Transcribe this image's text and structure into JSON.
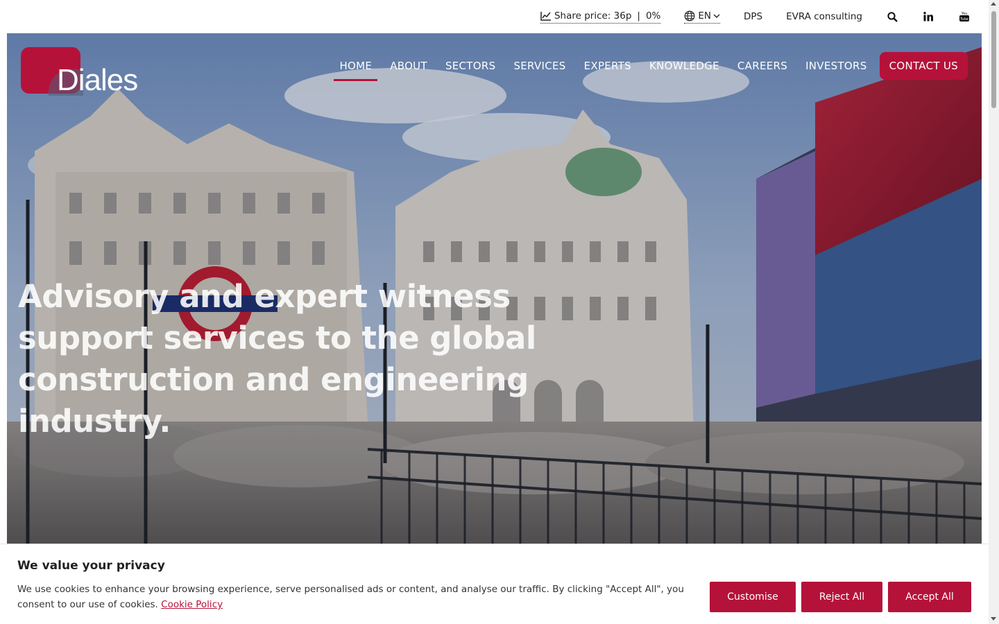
{
  "topbar": {
    "share_price_label": "Share price: 36p",
    "share_separator": "|",
    "share_change": "0%",
    "language": "EN",
    "dps_label": "DPS",
    "evra_label": "EVRA consulting"
  },
  "logo": {
    "text": "Diales"
  },
  "nav": {
    "items": [
      {
        "label": "HOME"
      },
      {
        "label": "ABOUT"
      },
      {
        "label": "SECTORS"
      },
      {
        "label": "SERVICES"
      },
      {
        "label": "EXPERTS"
      },
      {
        "label": "KNOWLEDGE"
      },
      {
        "label": "CAREERS"
      },
      {
        "label": "INVESTORS"
      }
    ],
    "contact_label": "CONTACT US",
    "active": "HOME"
  },
  "hero": {
    "headline": "Advisory and expert witness support services to the global construction and engineering industry."
  },
  "cookie": {
    "title": "We value your privacy",
    "text": "We use cookies to enhance your browsing experience, serve personalised ads or content, and analyse our traffic. By clicking \"Accept All\", you consent to our use of cookies.",
    "policy_link": "Cookie Policy",
    "customise_label": "Customise",
    "reject_label": "Reject All",
    "accept_label": "Accept All"
  },
  "colors": {
    "brand": "#b5123a",
    "text": "#222222"
  },
  "icons": [
    "chart-line-icon",
    "globe-icon",
    "chevron-down-icon",
    "search-icon",
    "linkedin-icon",
    "youtube-icon"
  ]
}
